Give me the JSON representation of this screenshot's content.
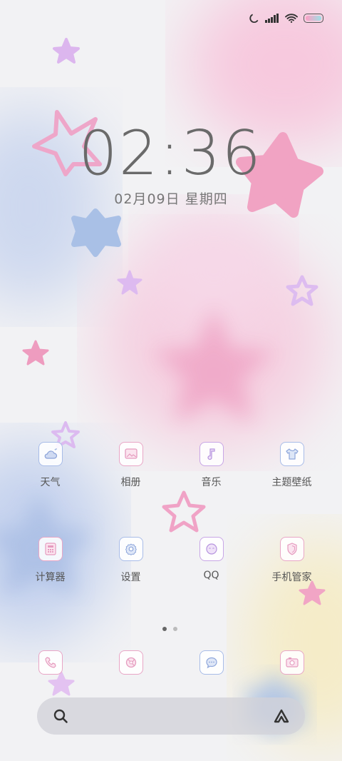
{
  "clock": {
    "time": "02:36",
    "date": "02月09日 星期四"
  },
  "status_bar": {
    "icons": [
      "moon-icon",
      "signal-icon",
      "wifi-icon",
      "battery-icon"
    ]
  },
  "apps_row1": [
    {
      "label": "天气",
      "icon": "weather-icon"
    },
    {
      "label": "相册",
      "icon": "gallery-icon"
    },
    {
      "label": "音乐",
      "icon": "music-icon"
    },
    {
      "label": "主题壁纸",
      "icon": "theme-icon"
    }
  ],
  "apps_row2": [
    {
      "label": "计算器",
      "icon": "calculator-icon"
    },
    {
      "label": "设置",
      "icon": "settings-icon"
    },
    {
      "label": "QQ",
      "icon": "qq-icon"
    },
    {
      "label": "手机管家",
      "icon": "security-icon"
    }
  ],
  "dock": [
    {
      "icon": "phone-icon"
    },
    {
      "icon": "browser-icon"
    },
    {
      "icon": "messages-icon"
    },
    {
      "icon": "camera-icon"
    }
  ],
  "page_indicator": {
    "pages": 2,
    "current": 1
  },
  "search_bar": {
    "left_icon": "search-icon",
    "right_icon": "assistant-icon"
  },
  "colors": {
    "pink": "#f0a6c8",
    "blue": "#a9bfe6",
    "lavender": "#d9b8ee",
    "text": "#555555"
  }
}
